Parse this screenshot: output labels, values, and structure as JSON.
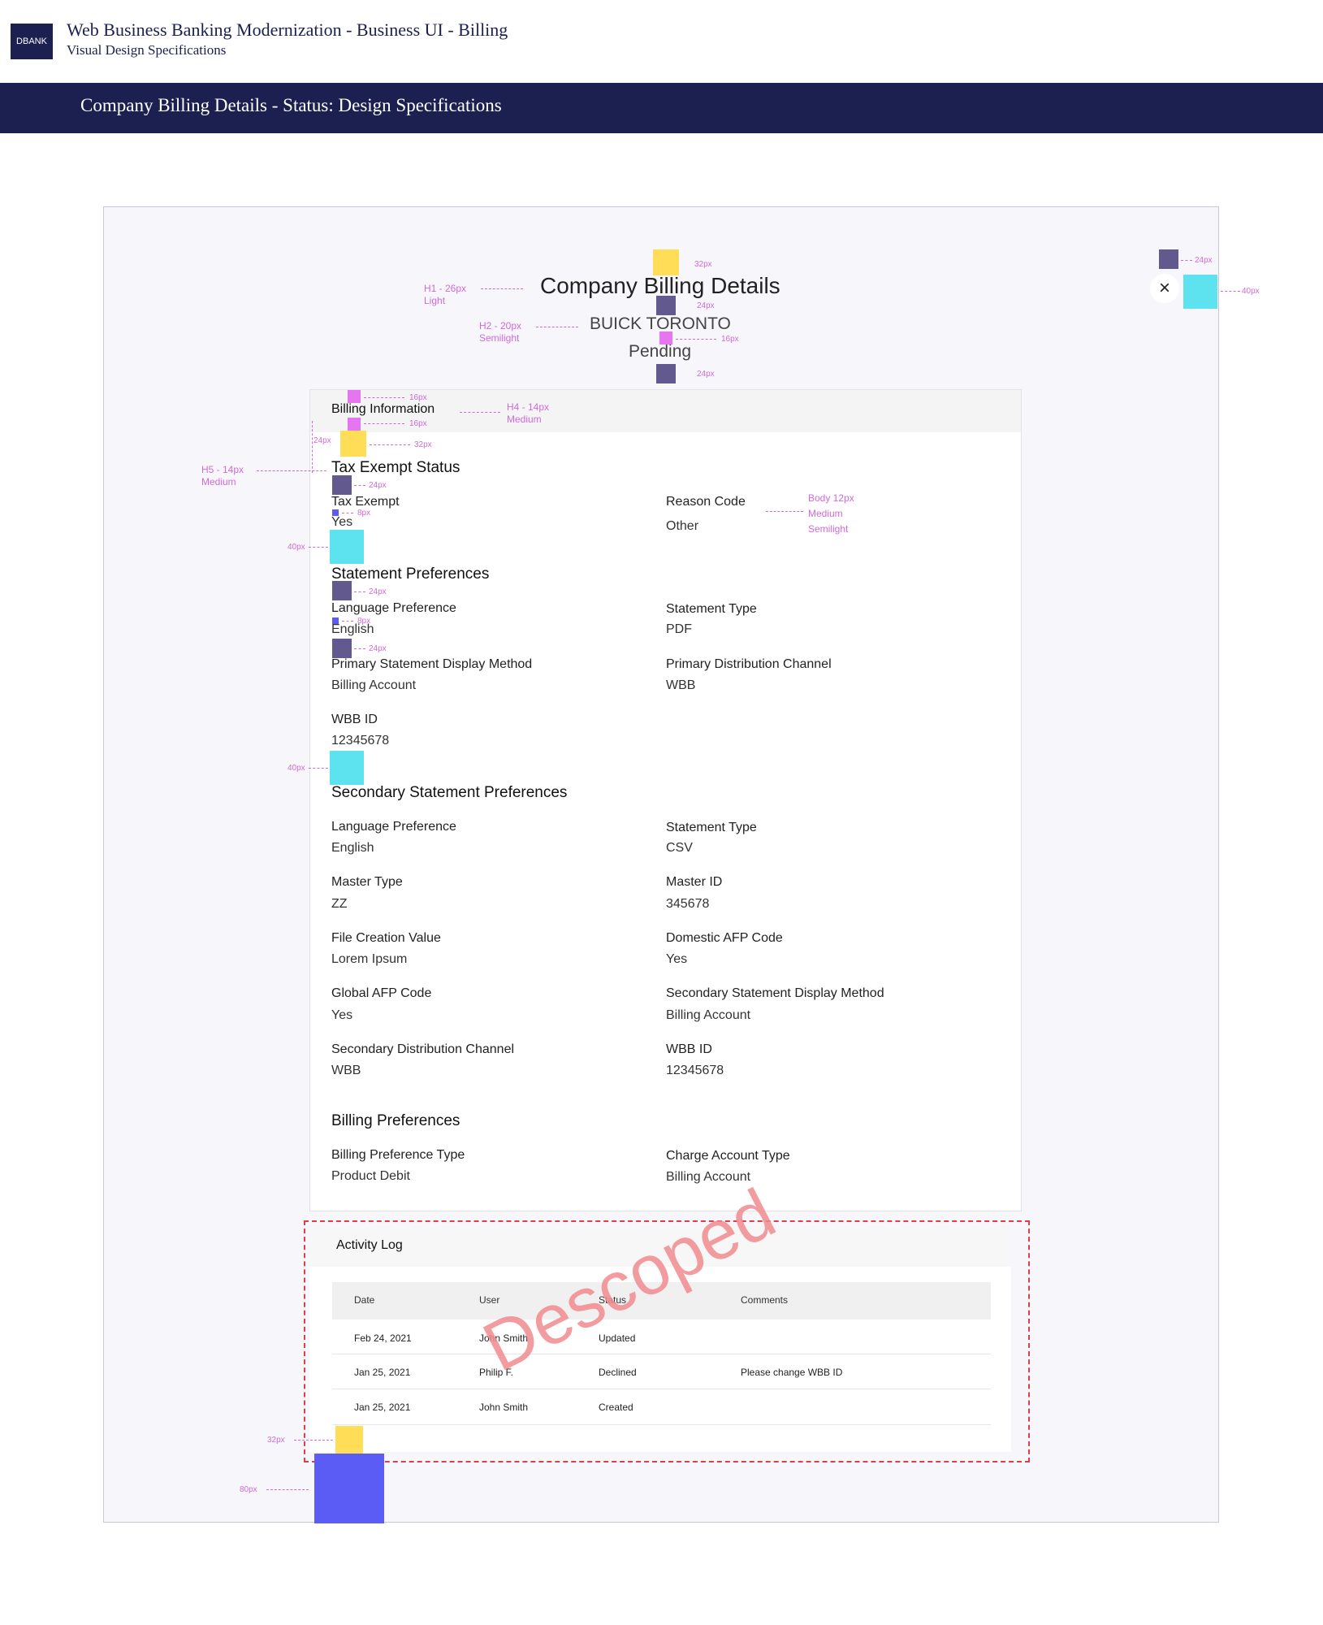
{
  "doc": {
    "logo": "DBANK",
    "title": "Web Business Banking Modernization - Business UI - Billing",
    "subtitle": "Visual Design Specifications",
    "banner": "Company Billing Details - Status: Design Specifications"
  },
  "modal": {
    "title": "Company Billing Details",
    "company": "BUICK TORONTO",
    "status": "Pending",
    "close_icon": "×"
  },
  "billing_info": {
    "heading": "Billing Information",
    "tax_section": "Tax Exempt Status",
    "tax_exempt_label": "Tax Exempt",
    "tax_exempt_value": "Yes",
    "reason_label": "Reason Code",
    "reason_value": "Other"
  },
  "statement_prefs": {
    "heading": "Statement Preferences",
    "fields": [
      {
        "label": "Language Preference",
        "value": "English"
      },
      {
        "label": "Statement Type",
        "value": "PDF"
      },
      {
        "label": "Primary Statement Display Method",
        "value": "Billing Account"
      },
      {
        "label": "Primary Distribution Channel",
        "value": "WBB"
      },
      {
        "label": "WBB ID",
        "value": "12345678"
      }
    ]
  },
  "secondary_prefs": {
    "heading": "Secondary Statement Preferences",
    "fields": [
      {
        "label": "Language Preference",
        "value": "English"
      },
      {
        "label": "Statement Type",
        "value": "CSV"
      },
      {
        "label": "Master Type",
        "value": "ZZ"
      },
      {
        "label": "Master ID",
        "value": "345678"
      },
      {
        "label": "File Creation Value",
        "value": "Lorem Ipsum"
      },
      {
        "label": "Domestic AFP Code",
        "value": "Yes"
      },
      {
        "label": "Global AFP Code",
        "value": "Yes"
      },
      {
        "label": "Secondary Statement Display Method",
        "value": "Billing Account"
      },
      {
        "label": "Secondary Distribution Channel",
        "value": "WBB"
      },
      {
        "label": "WBB ID",
        "value": "12345678"
      }
    ]
  },
  "billing_prefs": {
    "heading": "Billing Preferences",
    "fields": [
      {
        "label": "Billing Preference Type",
        "value": "Product Debit"
      },
      {
        "label": "Charge Account Type",
        "value": "Billing Account"
      }
    ]
  },
  "activity_log": {
    "heading": "Activity Log",
    "columns": [
      "Date",
      "User",
      "Status",
      "Comments"
    ],
    "rows": [
      [
        "Feb 24, 2021",
        "John Smith",
        "Updated",
        ""
      ],
      [
        "Jan 25, 2021",
        "Philip F.",
        "Declined",
        "Please change WBB ID"
      ],
      [
        "Jan 25, 2021",
        "John Smith",
        "Created",
        ""
      ]
    ],
    "stamp": "Descoped"
  },
  "annotations": {
    "h1_spec": "H1  - 26px",
    "h1_weight": "Light",
    "h2_spec": "H2  - 20px",
    "h2_weight": "Semilight",
    "h4_spec": "H4  - 14px",
    "h4_weight": "Medium",
    "h5_spec": "H5  - 14px",
    "h5_weight": "Medium",
    "body_spec": "Body 12px",
    "body_w1": "Medium",
    "body_w2": "Semilight",
    "px8": "8px",
    "px16": "16px",
    "px24": "24px",
    "px32": "32px",
    "px40": "40px",
    "px80": "80px"
  },
  "colors": {
    "navy": "#1c2051",
    "spec_magenta": "#d06ad9",
    "spacer_yellow": "#ffdd57",
    "spacer_purple": "#625a8f",
    "spacer_pink": "#e576f0",
    "spacer_cyan": "#5ce3ef",
    "spacer_blue": "#5b5bf5",
    "descope_red": "#d8414a"
  }
}
